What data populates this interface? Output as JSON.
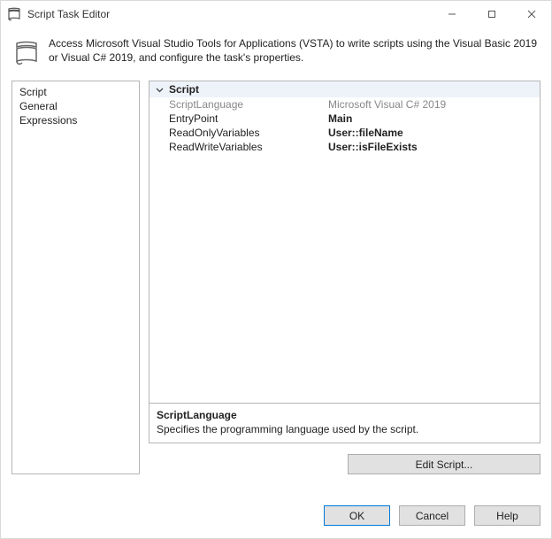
{
  "window": {
    "title": "Script Task Editor",
    "description": "Access Microsoft Visual Studio Tools for Applications (VSTA) to write scripts using the Visual Basic 2019 or Visual C# 2019, and configure the task's properties."
  },
  "nav": {
    "items": [
      "Script",
      "General",
      "Expressions"
    ]
  },
  "grid": {
    "category": "Script",
    "rows": [
      {
        "name": "ScriptLanguage",
        "value": "Microsoft Visual C# 2019",
        "readonly": true
      },
      {
        "name": "EntryPoint",
        "value": "Main",
        "readonly": false
      },
      {
        "name": "ReadOnlyVariables",
        "value": "User::fileName",
        "readonly": false
      },
      {
        "name": "ReadWriteVariables",
        "value": "User::isFileExists",
        "readonly": false
      }
    ]
  },
  "help": {
    "title": "ScriptLanguage",
    "body": "Specifies the programming language used by the script."
  },
  "buttons": {
    "edit_script": "Edit Script...",
    "ok": "OK",
    "cancel": "Cancel",
    "help": "Help"
  }
}
